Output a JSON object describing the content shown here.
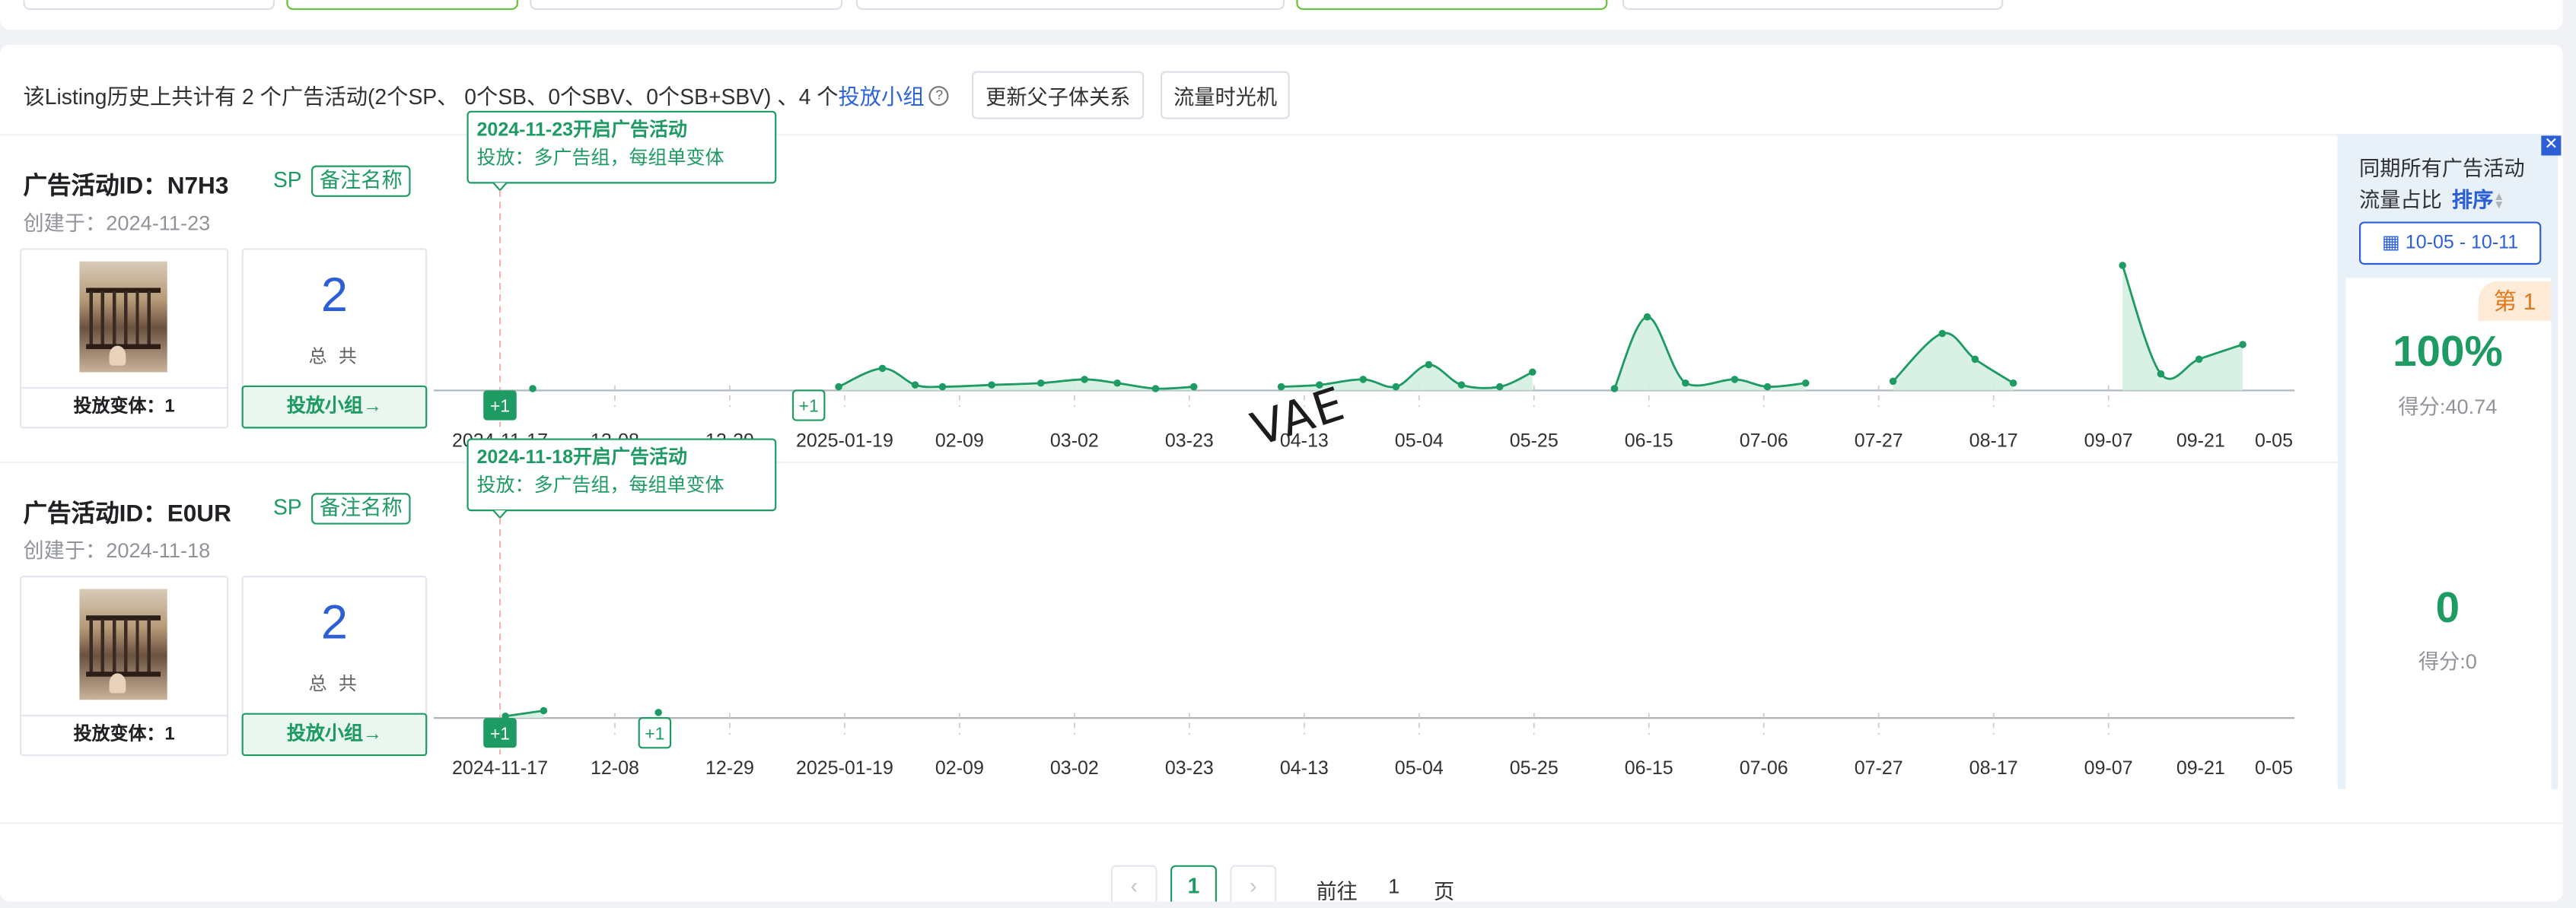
{
  "summary": {
    "text": "该Listing历史上共计有 2 个广告活动(2个SP、 0个SB、0个SBV、0个SB+SBV) 、4 个",
    "link": "投放小组",
    "help_icon": "question-circle-icon",
    "btn_parent_child": "更新父子体关系",
    "btn_time_machine": "流量时光机"
  },
  "campaigns": [
    {
      "title": "广告活动ID：N7H3",
      "type": "SP",
      "remark": "备注名称",
      "created": "创建于：2024-11-23",
      "variant_label": "投放变体：1",
      "total_count": "2",
      "total_label": "总 共",
      "group_button": "投放小组→",
      "event_title": "2024-11-23开启广告活动",
      "event_desc": "投放：多广告组，每组单变体",
      "markers": [
        "+1",
        "+1"
      ],
      "score_pct": "100%",
      "score_text": "得分:40.74"
    },
    {
      "title": "广告活动ID：E0UR",
      "type": "SP",
      "remark": "备注名称",
      "created": "创建于：2024-11-18",
      "variant_label": "投放变体：1",
      "total_count": "2",
      "total_label": "总 共",
      "group_button": "投放小组→",
      "event_title": "2024-11-18开启广告活动",
      "event_desc": "投放：多广告组，每组单变体",
      "markers": [
        "+1",
        "+1"
      ],
      "score_pct": "0",
      "score_text": "得分:0"
    }
  ],
  "chart_data": [
    {
      "type": "area",
      "x_ticks": [
        "2024-11-17",
        "12-08",
        "12-29",
        "2025-01-19",
        "02-09",
        "03-02",
        "03-23",
        "04-13",
        "05-04",
        "05-25",
        "06-15",
        "07-06",
        "07-27",
        "08-17",
        "09-07",
        "09-21",
        "0-05"
      ],
      "x_start": "2024-11-17",
      "segments": [
        [
          [
            "2024-11-23",
            1
          ]
        ],
        [
          [
            "2025-01-18",
            2
          ],
          [
            "2025-01-26",
            12
          ],
          [
            "2025-02-01",
            3
          ],
          [
            "2025-02-06",
            2
          ],
          [
            "2025-02-15",
            3
          ],
          [
            "2025-02-24",
            4
          ],
          [
            "2025-03-04",
            6
          ],
          [
            "2025-03-10",
            4
          ],
          [
            "2025-03-17",
            1
          ],
          [
            "2025-03-24",
            2
          ]
        ],
        [
          [
            "2025-04-09",
            2
          ],
          [
            "2025-04-16",
            3
          ],
          [
            "2025-04-24",
            6
          ],
          [
            "2025-04-30",
            2
          ],
          [
            "2025-05-06",
            14
          ],
          [
            "2025-05-12",
            3
          ],
          [
            "2025-05-19",
            2
          ],
          [
            "2025-05-25",
            10
          ]
        ],
        [
          [
            "2025-06-09",
            1
          ],
          [
            "2025-06-15",
            40
          ],
          [
            "2025-06-22",
            4
          ],
          [
            "2025-07-01",
            6
          ],
          [
            "2025-07-07",
            2
          ],
          [
            "2025-07-14",
            4
          ]
        ],
        [
          [
            "2025-07-30",
            5
          ],
          [
            "2025-08-08",
            31
          ],
          [
            "2025-08-14",
            17
          ],
          [
            "2025-08-21",
            4
          ]
        ],
        [
          [
            "2025-09-10",
            68
          ],
          [
            "2025-09-17",
            9
          ],
          [
            "2025-09-24",
            17
          ],
          [
            "2025-10-02",
            25
          ]
        ]
      ],
      "ylim": [
        0,
        72
      ]
    },
    {
      "type": "area",
      "x_ticks": [
        "2024-11-17",
        "12-08",
        "12-29",
        "2025-01-19",
        "02-09",
        "03-02",
        "03-23",
        "04-13",
        "05-04",
        "05-25",
        "06-15",
        "07-06",
        "07-27",
        "08-17",
        "09-07",
        "09-21",
        "0-05"
      ],
      "x_start": "2024-11-17",
      "segments": [
        [
          [
            "2024-11-18",
            1
          ],
          [
            "2024-11-25",
            4
          ]
        ],
        [
          [
            "2024-12-16",
            3
          ]
        ]
      ],
      "ylim": [
        0,
        72
      ]
    }
  ],
  "side_panel": {
    "title_line1": "同期所有广告活动",
    "title_line2": "流量占比",
    "sort_label": "排序",
    "date_range": "10-05 - 10-11",
    "rank_badge": "第 1",
    "close_icon": "close-icon",
    "calendar_icon": "calendar-icon"
  },
  "pager": {
    "prev_icon": "chevron-left-icon",
    "next_icon": "chevron-right-icon",
    "current_page": "1",
    "goto_label": "前往",
    "goto_value": "1",
    "page_suffix": "页"
  },
  "watermark": "VAE",
  "colors": {
    "accent_green": "#1e9b63",
    "link_blue": "#2c63d8",
    "area_fill": "#d4efe1"
  }
}
